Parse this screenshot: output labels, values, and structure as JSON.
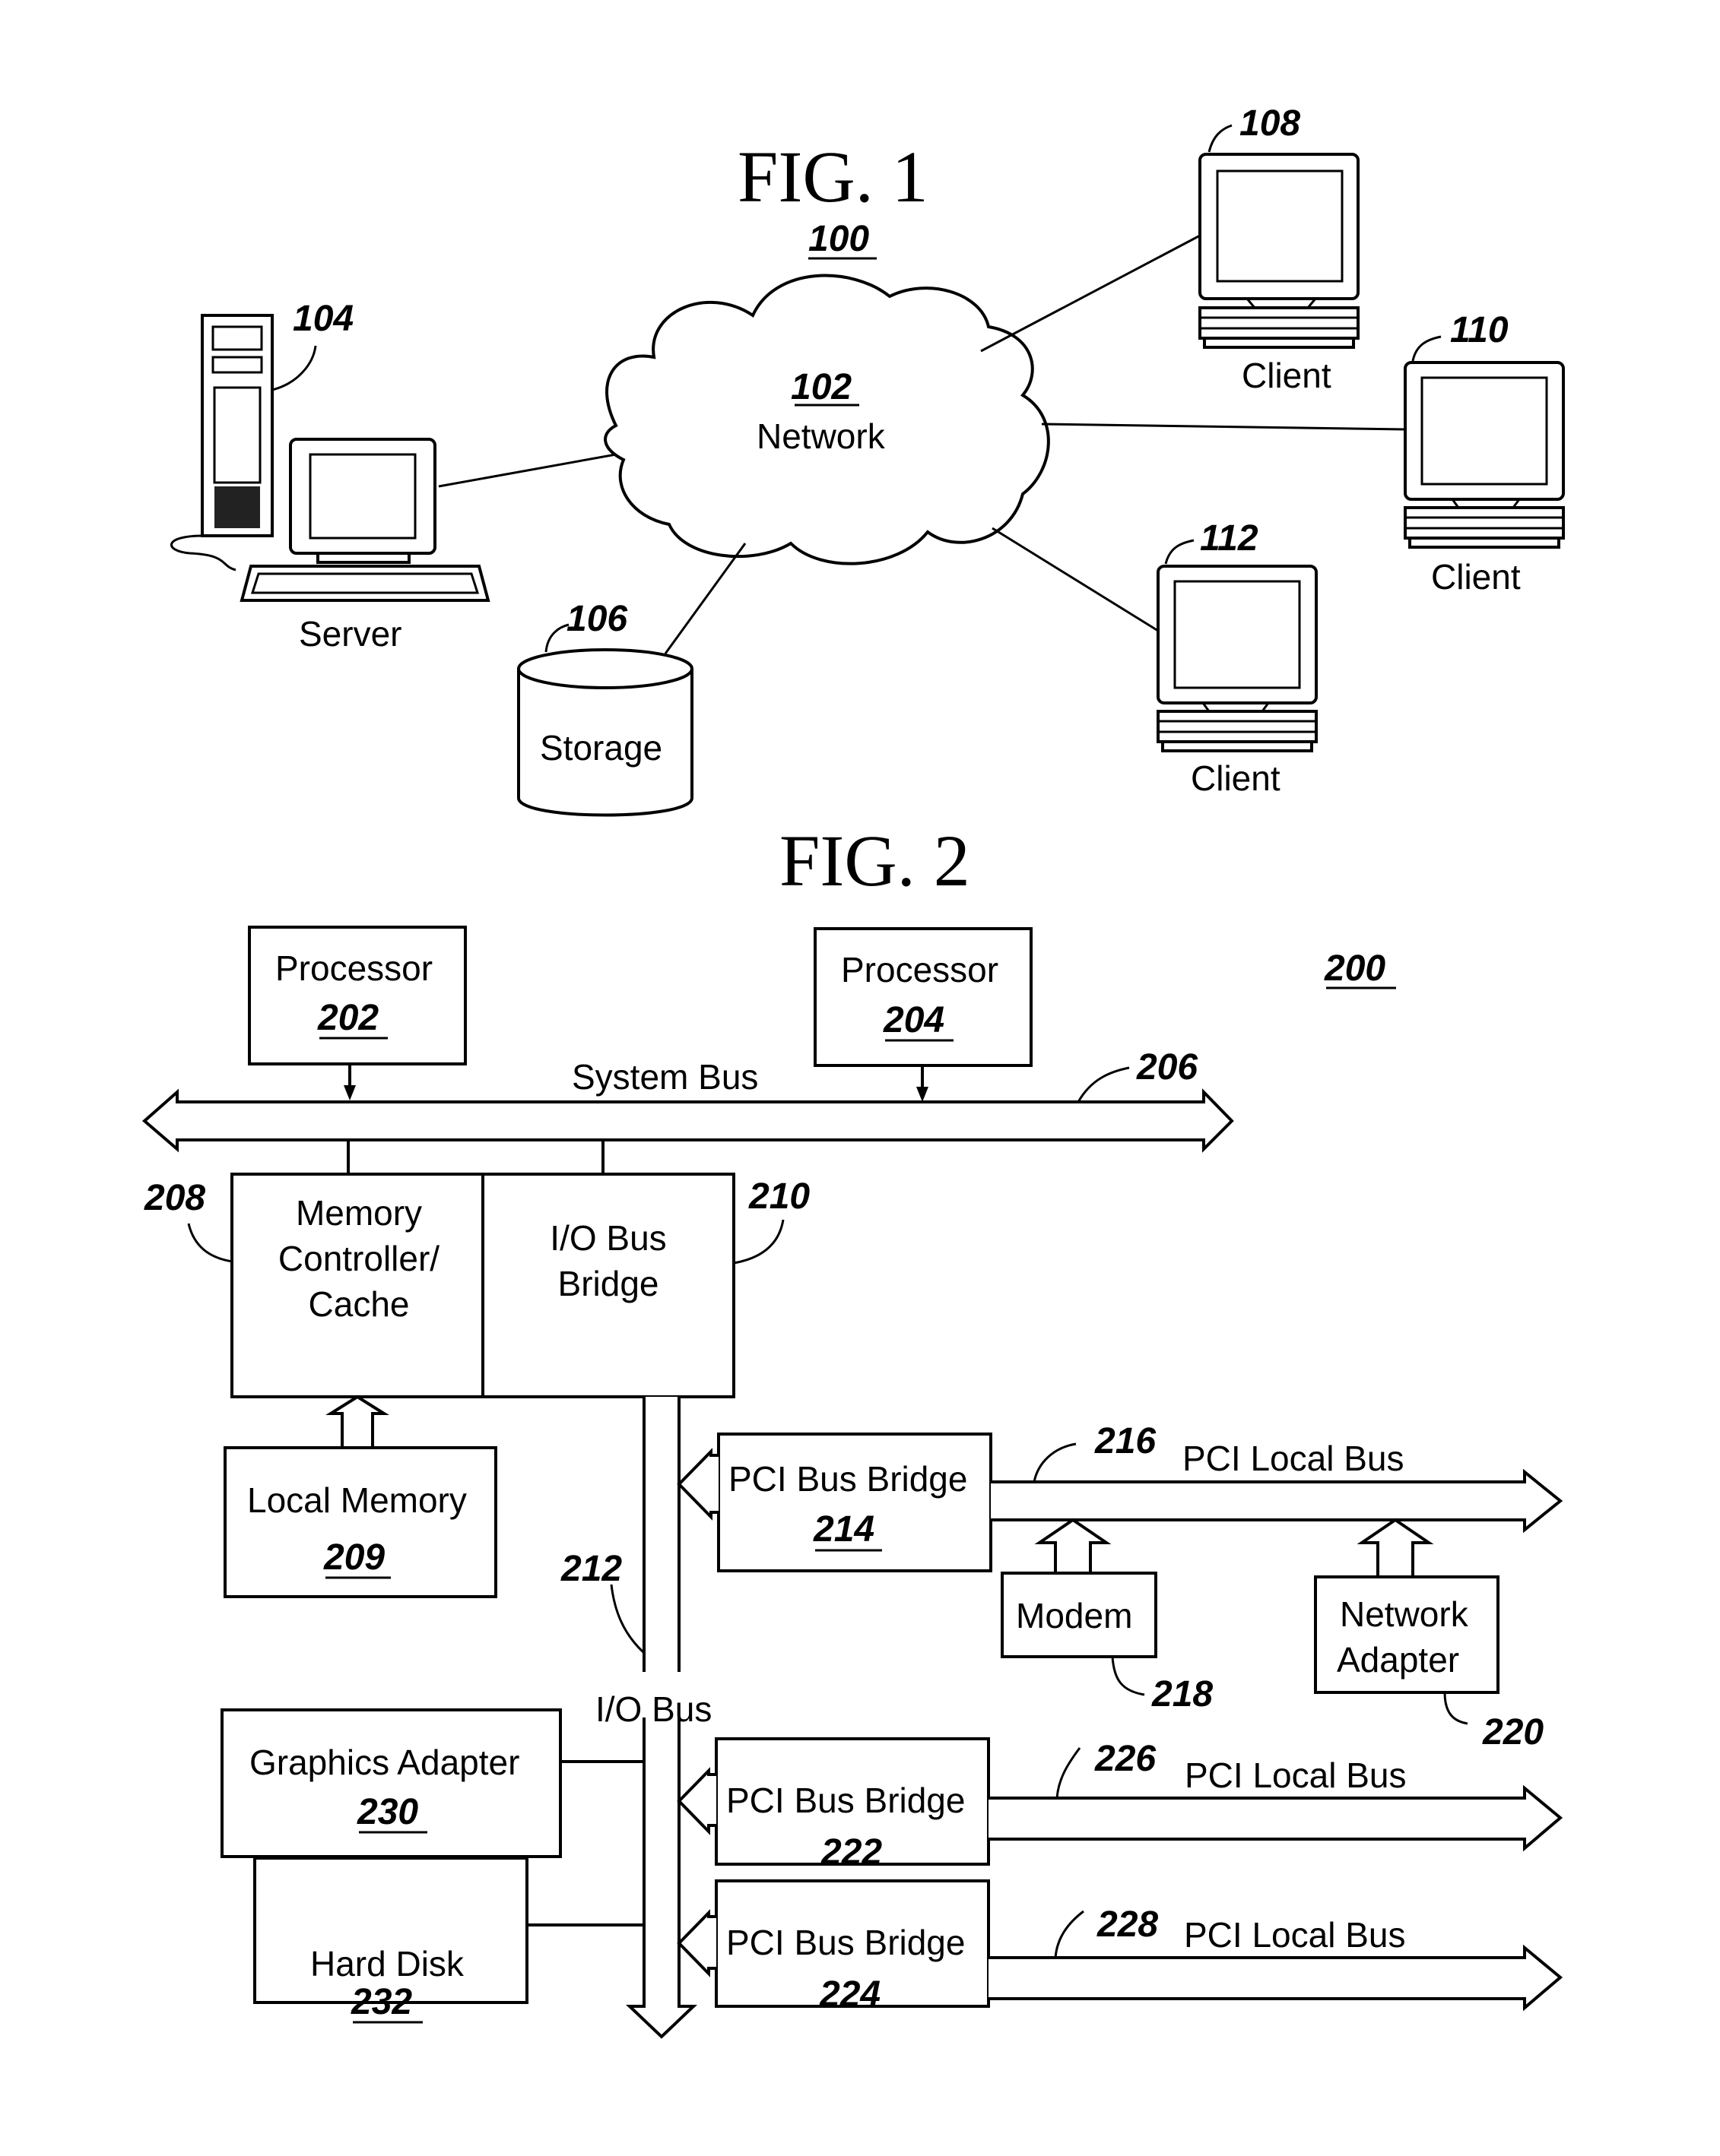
{
  "fig1": {
    "title": "FIG. 1",
    "ref": "100",
    "network": {
      "ref": "102",
      "label": "Network"
    },
    "server": {
      "ref": "104",
      "label": "Server"
    },
    "storage": {
      "ref": "106",
      "label": "Storage"
    },
    "clients": [
      {
        "ref": "108",
        "label": "Client"
      },
      {
        "ref": "110",
        "label": "Client"
      },
      {
        "ref": "112",
        "label": "Client"
      }
    ]
  },
  "fig2": {
    "title": "FIG. 2",
    "ref": "200",
    "processor_a": {
      "label": "Processor",
      "ref": "202"
    },
    "processor_b": {
      "label": "Processor",
      "ref": "204"
    },
    "system_bus": {
      "label": "System Bus",
      "ref": "206"
    },
    "memory_controller": {
      "lines": [
        "Memory",
        "Controller/",
        "Cache"
      ],
      "ref": "208"
    },
    "io_bridge": {
      "lines": [
        "I/O Bus",
        "Bridge"
      ],
      "ref": "210"
    },
    "local_memory": {
      "label": "Local Memory",
      "ref": "209"
    },
    "io_bus": {
      "label": "I/O Bus",
      "ref": "212"
    },
    "pci_bridge_1": {
      "label": "PCI Bus Bridge",
      "ref": "214"
    },
    "pci_local_bus_1": {
      "label": "PCI Local Bus",
      "ref": "216"
    },
    "modem": {
      "label": "Modem",
      "ref": "218"
    },
    "network_adapter": {
      "lines": [
        "Network",
        "Adapter"
      ],
      "ref": "220"
    },
    "pci_bridge_2": {
      "label": "PCI Bus Bridge",
      "ref": "222"
    },
    "pci_bridge_3": {
      "label": "PCI Bus Bridge",
      "ref": "224"
    },
    "pci_local_bus_2": {
      "label": "PCI Local Bus",
      "ref": "226"
    },
    "pci_local_bus_3": {
      "label": "PCI Local Bus",
      "ref": "228"
    },
    "graphics_adapter": {
      "label": "Graphics Adapter",
      "ref": "230"
    },
    "hard_disk": {
      "label": "Hard Disk",
      "ref": "232"
    }
  }
}
